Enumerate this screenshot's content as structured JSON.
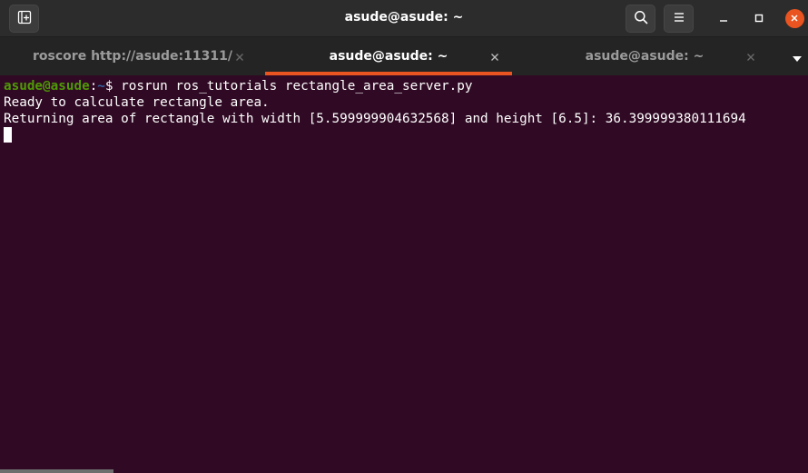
{
  "window": {
    "title": "asude@asude: ~",
    "new_tab_icon": "new-tab-icon",
    "search_icon": "search-icon",
    "menu_icon": "hamburger-menu-icon",
    "close_color": "#e95420"
  },
  "tabs": [
    {
      "label": "roscore http://asude:11311/",
      "active": false
    },
    {
      "label": "asude@asude: ~",
      "active": true
    },
    {
      "label": "asude@asude: ~",
      "active": false
    }
  ],
  "terminal": {
    "prompt_user": "asude@asude",
    "prompt_sep": ":",
    "prompt_path": "~",
    "prompt_symbol": "$ ",
    "command": "rosrun ros_tutorials rectangle_area_server.py",
    "output": [
      "Ready to calculate rectangle area.",
      "Returning area of rectangle with width [5.599999904632568] and height [6.5]: 36.399999380111694"
    ],
    "background": "#300a24",
    "accent": "#e95420"
  }
}
